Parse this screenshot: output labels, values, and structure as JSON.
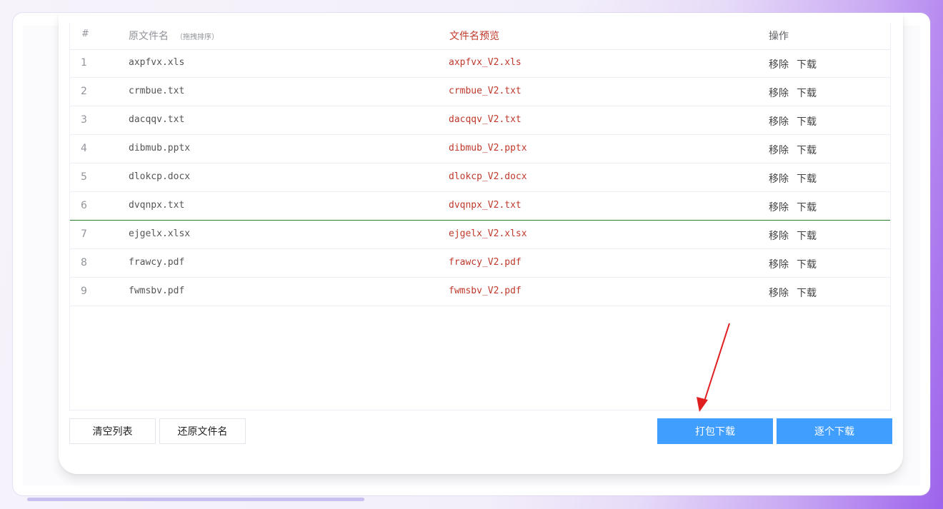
{
  "table": {
    "headers": {
      "index": "#",
      "original": "原文件名",
      "original_hint": "（拖拽排序）",
      "preview": "文件名预览",
      "actions": "操作"
    },
    "rows": [
      {
        "index": "1",
        "original": "axpfvx.xls",
        "preview": "axpfvx_V2.xls",
        "remove": "移除",
        "download": "下载"
      },
      {
        "index": "2",
        "original": "crmbue.txt",
        "preview": "crmbue_V2.txt",
        "remove": "移除",
        "download": "下载"
      },
      {
        "index": "3",
        "original": "dacqqv.txt",
        "preview": "dacqqv_V2.txt",
        "remove": "移除",
        "download": "下载"
      },
      {
        "index": "4",
        "original": "dibmub.pptx",
        "preview": "dibmub_V2.pptx",
        "remove": "移除",
        "download": "下载"
      },
      {
        "index": "5",
        "original": "dlokcp.docx",
        "preview": "dlokcp_V2.docx",
        "remove": "移除",
        "download": "下载"
      },
      {
        "index": "6",
        "original": "dvqnpx.txt",
        "preview": "dvqnpx_V2.txt",
        "remove": "移除",
        "download": "下载"
      },
      {
        "index": "7",
        "original": "ejgelx.xlsx",
        "preview": "ejgelx_V2.xlsx",
        "remove": "移除",
        "download": "下载"
      },
      {
        "index": "8",
        "original": "frawcy.pdf",
        "preview": "frawcy_V2.pdf",
        "remove": "移除",
        "download": "下载"
      },
      {
        "index": "9",
        "original": "fwmsbv.pdf",
        "preview": "fwmsbv_V2.pdf",
        "remove": "移除",
        "download": "下载"
      }
    ]
  },
  "buttons": {
    "clear_list": "清空列表",
    "restore_names": "还原文件名",
    "zip_download": "打包下载",
    "download_each": "逐个下载"
  },
  "colors": {
    "primary": "#409eff",
    "preview_text": "#c0392b",
    "annotation_arrow": "#e02020",
    "drag_marker": "#2e7d32"
  }
}
